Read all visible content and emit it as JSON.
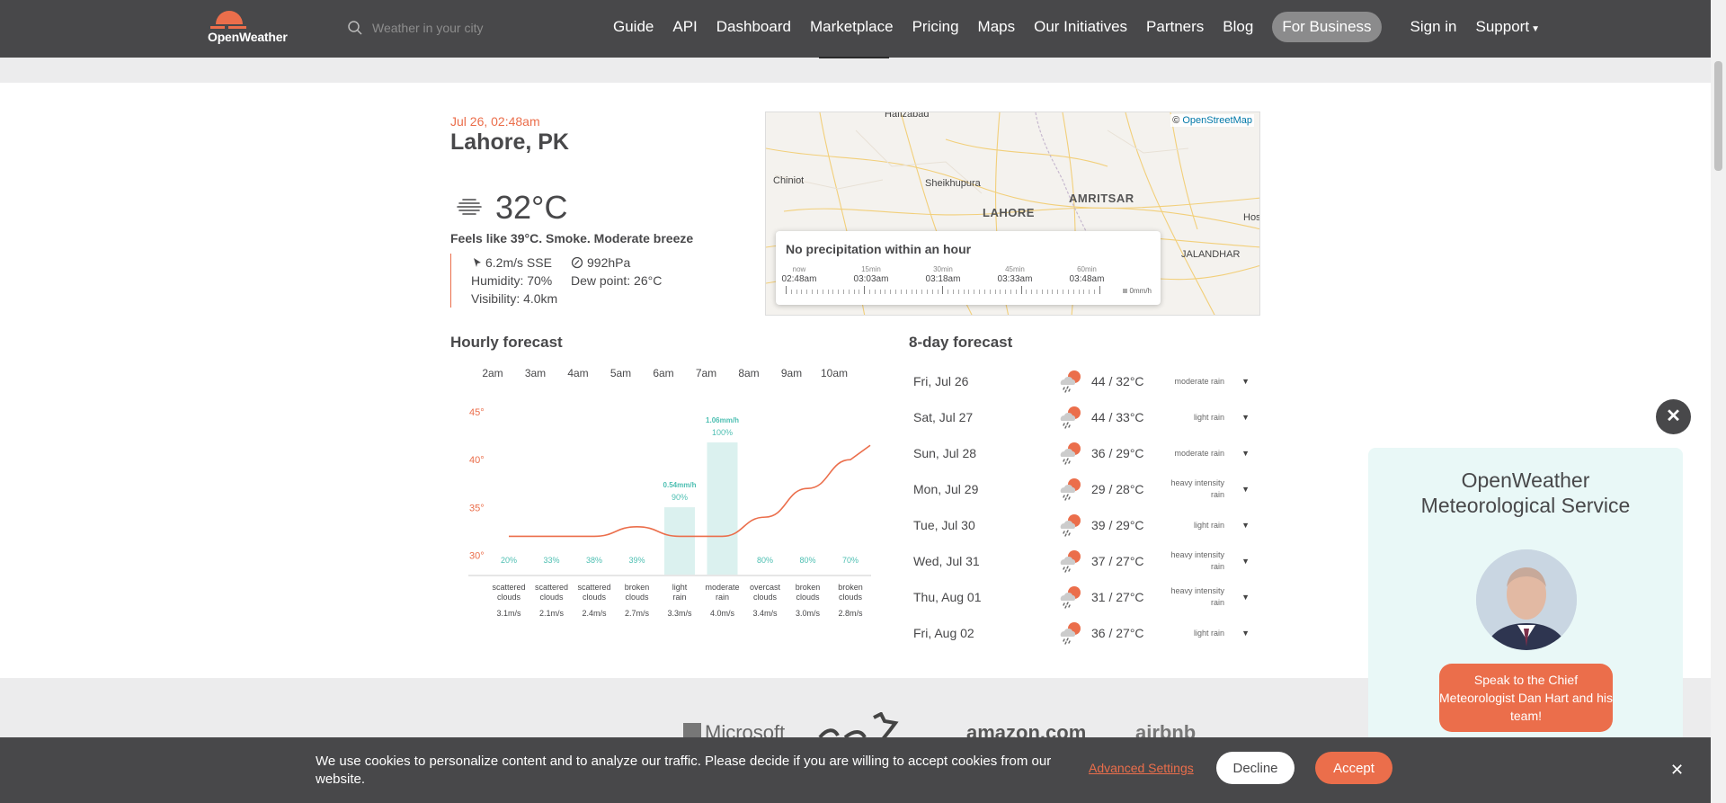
{
  "header": {
    "logo_text": "OpenWeather",
    "search_placeholder": "Weather in your city",
    "nav": [
      "Guide",
      "API",
      "Dashboard",
      "Marketplace",
      "Pricing",
      "Maps",
      "Our Initiatives",
      "Partners",
      "Blog"
    ],
    "business_label": "For Business",
    "signin_label": "Sign in",
    "support_label": "Support",
    "accent_color": "#eb6e4b"
  },
  "current": {
    "datetime": "Jul 26, 02:48am",
    "city": "Lahore, PK",
    "icon": "haze-icon",
    "temp": "32°C",
    "feels": "Feels like 39°C. Smoke. Moderate breeze",
    "wind": "6.2m/s SSE",
    "pressure": "992hPa",
    "humidity": "Humidity: 70%",
    "dew": "Dew point: 26°C",
    "visibility": "Visibility: 4.0km"
  },
  "map": {
    "attribution_symbol": "©",
    "attribution_link": "OpenStreetMap",
    "places": [
      "Hafizabad",
      "Chiniot",
      "Sheikhupura",
      "LAHORE",
      "AMRITSAR",
      "Hos",
      "JALANDHAR"
    ],
    "precip_title": "No precipitation within an hour",
    "precip_times": [
      {
        "label": "now",
        "time": "02:48am"
      },
      {
        "label": "15min",
        "time": "03:03am"
      },
      {
        "label": "30min",
        "time": "03:18am"
      },
      {
        "label": "45min",
        "time": "03:33am"
      },
      {
        "label": "60min",
        "time": "03:48am"
      }
    ],
    "precip_legend": "0mm/h"
  },
  "hourly": {
    "title": "Hourly forecast",
    "hours": [
      "2am",
      "3am",
      "4am",
      "5am",
      "6am",
      "7am",
      "8am",
      "9am",
      "10am"
    ]
  },
  "chart_data": {
    "type": "line",
    "title": "",
    "x": [
      "2am",
      "3am",
      "4am",
      "5am",
      "6am",
      "7am",
      "8am",
      "9am",
      "10am"
    ],
    "y_ticks": [
      "45°",
      "40°",
      "35°",
      "30°"
    ],
    "ylim": [
      28,
      45
    ],
    "temperature": [
      32,
      32,
      32,
      33,
      32,
      32,
      34,
      37,
      40
    ],
    "precip_probability": [
      "20%",
      "33%",
      "38%",
      "39%",
      "90%",
      "100%",
      "80%",
      "80%",
      "70%"
    ],
    "precip_amount": [
      null,
      null,
      null,
      null,
      "0.54mm/h",
      "1.06mm/h",
      null,
      null,
      null
    ],
    "precip_values": [
      0,
      0,
      0,
      0,
      0.54,
      1.06,
      0,
      0,
      0
    ],
    "conditions": [
      [
        "scattered",
        "clouds"
      ],
      [
        "scattered",
        "clouds"
      ],
      [
        "scattered",
        "clouds"
      ],
      [
        "broken",
        "clouds"
      ],
      [
        "light",
        "rain"
      ],
      [
        "moderate",
        "rain"
      ],
      [
        "overcast",
        "clouds"
      ],
      [
        "broken",
        "clouds"
      ],
      [
        "broken",
        "clouds"
      ]
    ],
    "wind": [
      "3.1m/s",
      "2.1m/s",
      "2.4m/s",
      "2.7m/s",
      "3.3m/s",
      "4.0m/s",
      "3.4m/s",
      "3.0m/s",
      "2.8m/s"
    ],
    "line_color": "#eb6e4b",
    "bar_color": "#dbf1ef",
    "label_color": "#4dbfb2"
  },
  "daily": {
    "title": "8-day forecast",
    "days": [
      {
        "day": "Fri, Jul 26",
        "temps": "44 / 32°C",
        "desc": "moderate rain"
      },
      {
        "day": "Sat, Jul 27",
        "temps": "44 / 33°C",
        "desc": "light rain"
      },
      {
        "day": "Sun, Jul 28",
        "temps": "36 / 29°C",
        "desc": "moderate rain"
      },
      {
        "day": "Mon, Jul 29",
        "temps": "29 / 28°C",
        "desc": "heavy intensity rain"
      },
      {
        "day": "Tue, Jul 30",
        "temps": "39 / 29°C",
        "desc": "light rain"
      },
      {
        "day": "Wed, Jul 31",
        "temps": "37 / 27°C",
        "desc": "heavy intensity rain"
      },
      {
        "day": "Thu, Aug 01",
        "temps": "31 / 27°C",
        "desc": "heavy intensity rain"
      },
      {
        "day": "Fri, Aug 02",
        "temps": "36 / 27°C",
        "desc": "light rain"
      }
    ]
  },
  "partners": [
    "Microsoft",
    "amazon.com",
    "airbnb"
  ],
  "cookie": {
    "message": "We use cookies to personalize content and to analyze our traffic. Please decide if you are willing to accept cookies from our website.",
    "advanced": "Advanced Settings",
    "decline": "Decline",
    "accept": "Accept"
  },
  "meteo": {
    "title_line1": "OpenWeather",
    "title_line2": "Meteorological Service",
    "cta": "Speak to the Chief Meteorologist Dan Hart and his team!"
  }
}
